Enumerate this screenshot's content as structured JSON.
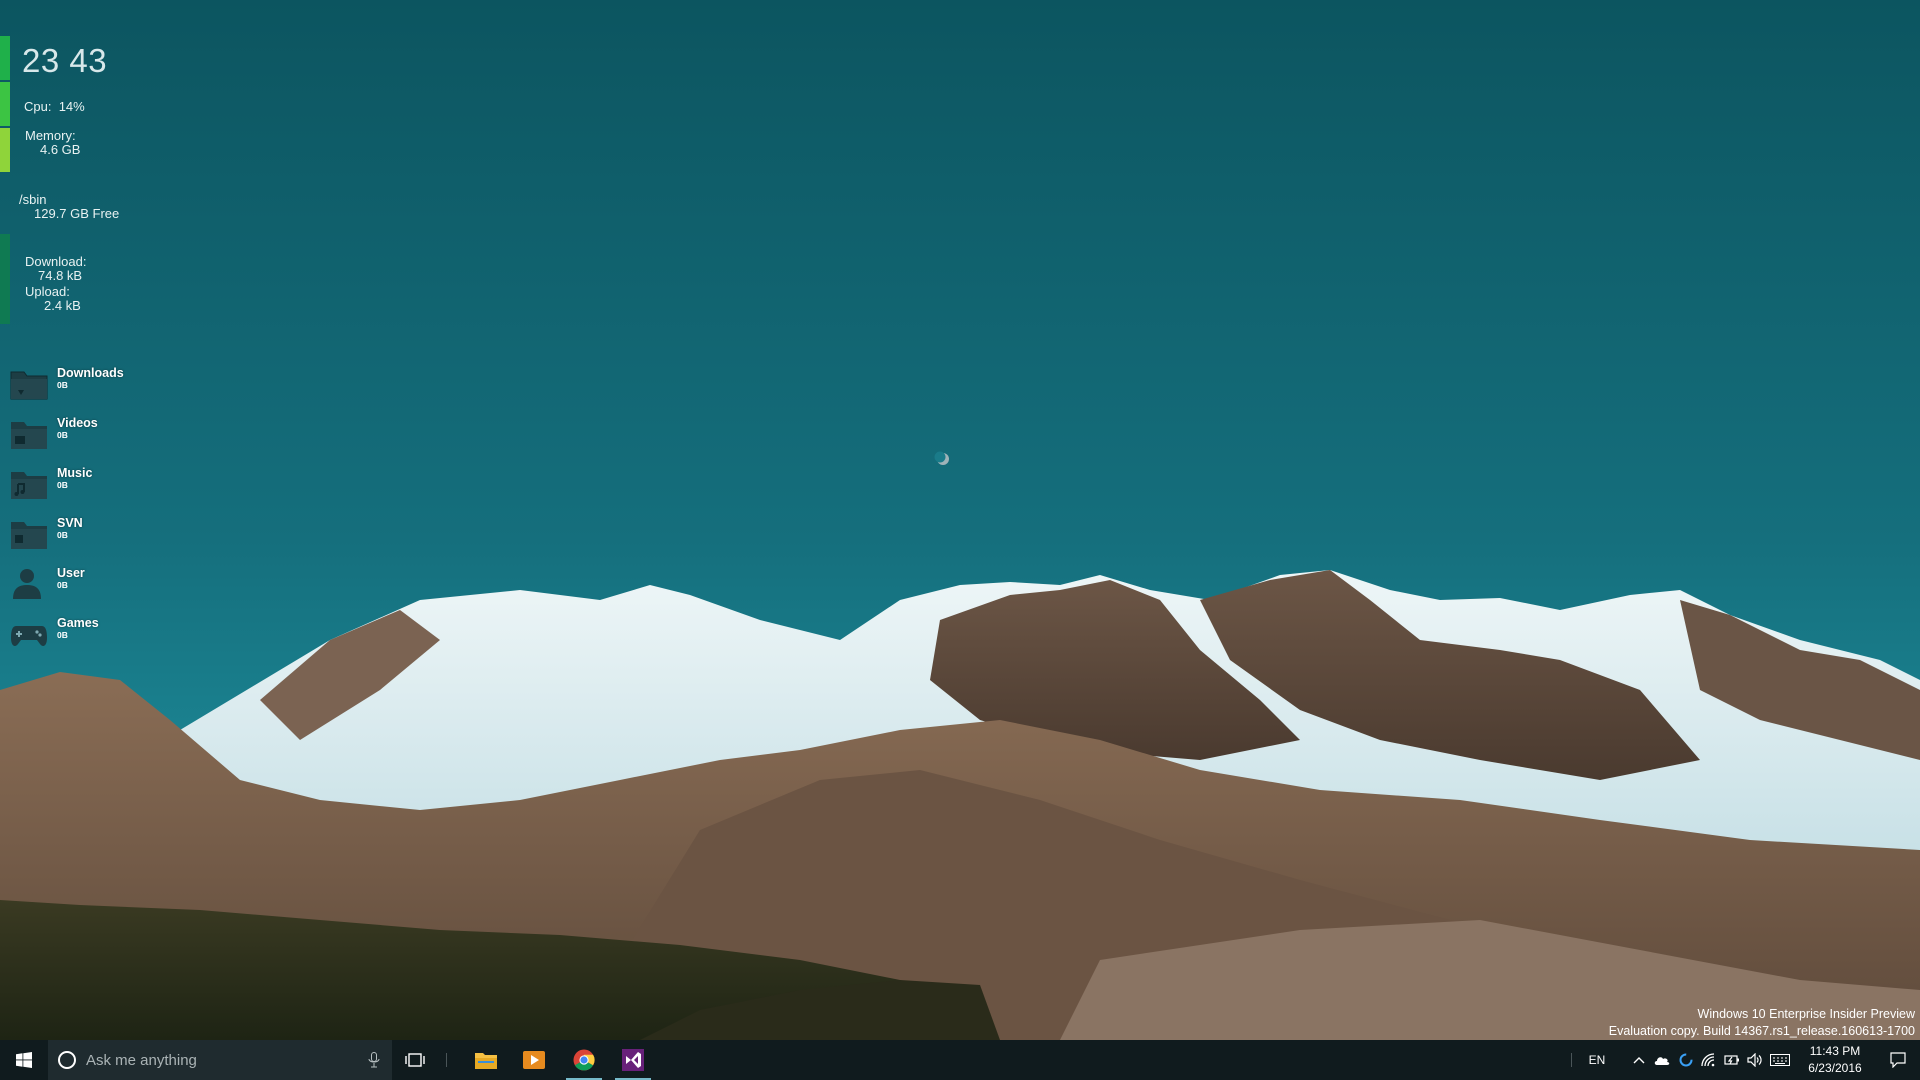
{
  "desktop": {
    "system_monitor": {
      "clock": "23 43",
      "cpu_label": "Cpu:",
      "cpu_value": "14%",
      "cpu_load_fraction": 0.14,
      "memory_label": "Memory:",
      "memory_value": "4.6 GB",
      "disk_path": "/sbin",
      "disk_free": "129.7 GB Free",
      "download_label": "Download:",
      "download_value": "74.8 kB",
      "upload_label": "Upload:",
      "upload_value": "2.4 kB"
    },
    "shortcuts": [
      {
        "label": "Downloads",
        "size": "0B",
        "icon": "folder-download-icon"
      },
      {
        "label": "Videos",
        "size": "0B",
        "icon": "folder-video-icon"
      },
      {
        "label": "Music",
        "size": "0B",
        "icon": "folder-music-icon"
      },
      {
        "label": "SVN",
        "size": "0B",
        "icon": "folder-svn-icon"
      },
      {
        "label": "User",
        "size": "0B",
        "icon": "user-icon"
      },
      {
        "label": "Games",
        "size": "0B",
        "icon": "gamepad-icon"
      }
    ],
    "watermark": {
      "line1": "Windows 10 Enterprise Insider Preview",
      "line2": "Evaluation copy. Build 14367.rs1_release.160613-1700"
    }
  },
  "taskbar": {
    "search_placeholder": "Ask me anything",
    "pinned_apps": [
      "file-explorer-icon",
      "media-player-icon",
      "chrome-icon",
      "visual-studio-icon"
    ],
    "language": "EN",
    "time": "11:43 PM",
    "date": "6/23/2016"
  },
  "colors": {
    "sky": "#0f6876",
    "taskbar": "#101b1e",
    "widget_bar_green": "#2ec24a",
    "widget_bar_lime": "#8fd43a",
    "widget_bar_dark": "#0f7a52",
    "active_app_underline": "#76b9c9"
  }
}
